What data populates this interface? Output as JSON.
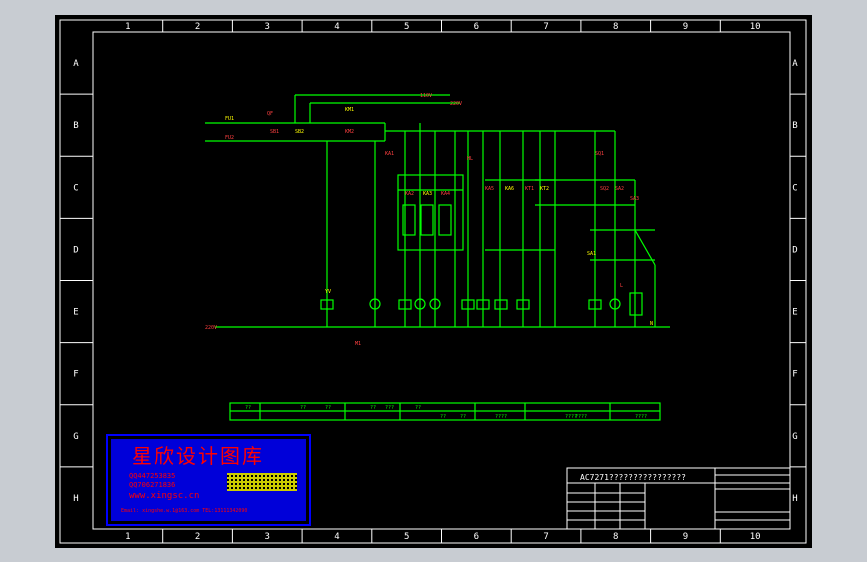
{
  "drawing": {
    "columns": [
      "1",
      "2",
      "3",
      "4",
      "5",
      "6",
      "7",
      "8",
      "9",
      "10"
    ],
    "rows": [
      "A",
      "B",
      "C",
      "D",
      "E",
      "F",
      "G",
      "H"
    ],
    "title": "AC7271????????????????",
    "colors": {
      "background": "#000000",
      "frame": "#ffffff",
      "wire": "#00ff00",
      "label": "#ff0000",
      "label_alt": "#ffff00",
      "stamp_bg": "#0000ff",
      "stamp_text": "#ff0000"
    }
  },
  "schematic": {
    "supply_labels": [
      "110V",
      "220V",
      "220V"
    ],
    "main_labels": [
      "FU1",
      "FU2",
      "QF",
      "KM1",
      "KM2",
      "SB1",
      "SB2",
      "KA1",
      "KA2",
      "KA3",
      "KA4",
      "KA5",
      "KA6",
      "HL",
      "KT1",
      "KT2",
      "SQ1",
      "SQ2",
      "SA1",
      "SA2",
      "SA3",
      "YV",
      "L",
      "M1",
      "N"
    ],
    "table_cells": [
      "??",
      "??",
      "??",
      "??",
      "???",
      "??",
      "??",
      "??",
      "????",
      "????",
      "????",
      "????"
    ]
  },
  "watermark": {
    "title": "星欣设计图库",
    "qq1": "QQ447253835",
    "qq2": "QQ706271836",
    "web": "www.xingsc.cn",
    "email": "Email: xingshe.w.1@163.com  TEL:13111342090"
  }
}
